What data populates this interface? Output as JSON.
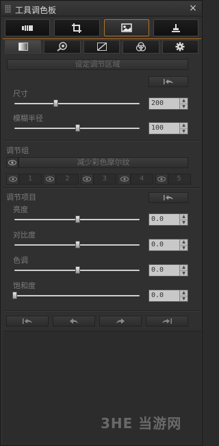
{
  "window": {
    "title": "工具调色板",
    "close_glyph": "×"
  },
  "tool_tabs": [
    {
      "icon": "brush-icon",
      "active": false
    },
    {
      "icon": "crop-icon",
      "active": false
    },
    {
      "icon": "image-adjust-icon",
      "active": true
    },
    {
      "icon": "stamp-icon",
      "active": false
    }
  ],
  "sub_tabs": [
    {
      "icon": "gradient-icon",
      "active": true
    },
    {
      "icon": "lens-icon",
      "active": false
    },
    {
      "icon": "curve-icon",
      "active": false
    },
    {
      "icon": "color-circles-icon",
      "active": false
    },
    {
      "icon": "gear-icon",
      "active": false
    }
  ],
  "region": {
    "button_label": "设定调节区域",
    "size_label": "尺寸",
    "size_value": "200",
    "size_fraction": 0.33,
    "feather_label": "模糊半径",
    "feather_value": "100",
    "feather_fraction": 0.5
  },
  "group": {
    "section_label": "调节组",
    "preset_label": "减少彩色摩尔纹",
    "slots": [
      "1",
      "2",
      "3",
      "4",
      "5"
    ]
  },
  "items": {
    "section_label": "调节项目",
    "rows": [
      {
        "key": "brightness",
        "label": "亮度",
        "value": "0.0",
        "fraction": 0.5
      },
      {
        "key": "contrast",
        "label": "对比度",
        "value": "0.0",
        "fraction": 0.5
      },
      {
        "key": "hue",
        "label": "色调",
        "value": "0.0",
        "fraction": 0.5
      },
      {
        "key": "saturation",
        "label": "饱和度",
        "value": "0.0",
        "fraction": 0.0
      }
    ]
  },
  "watermark": "3HE 当游网",
  "colors": {
    "accent": "#b26a1e",
    "panel": "#303030",
    "track": "#d0d0d0"
  }
}
